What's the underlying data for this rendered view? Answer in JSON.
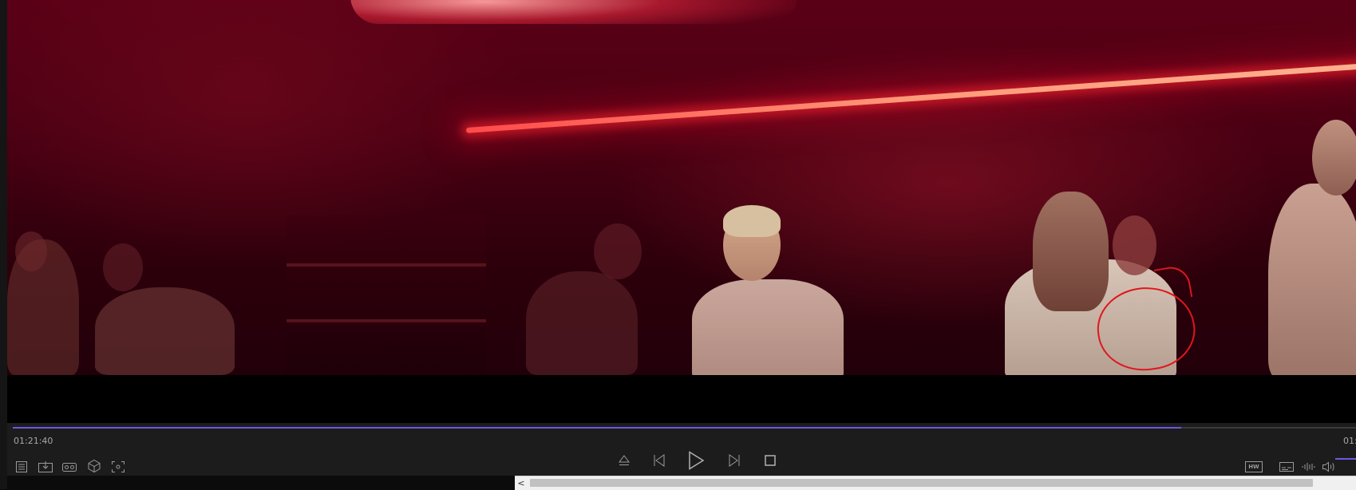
{
  "player": {
    "time_current": "01:21:40",
    "time_total": "01:",
    "progress": 0.87,
    "volume_level": 0.2,
    "accent_color": "#6e57e0",
    "controls_left": [
      {
        "icon": "playlist-icon"
      },
      {
        "icon": "download-icon"
      },
      {
        "icon": "vr-headset-icon"
      },
      {
        "icon": "3d-cube-icon"
      },
      {
        "icon": "screenshot-icon"
      }
    ],
    "controls_center": [
      {
        "icon": "eject-icon"
      },
      {
        "icon": "previous-track-icon"
      },
      {
        "icon": "play-icon"
      },
      {
        "icon": "next-track-icon"
      },
      {
        "icon": "stop-icon"
      }
    ],
    "controls_right": [
      {
        "icon": "hw-decoding-icon",
        "label": "HW"
      },
      {
        "icon": "subtitles-icon"
      },
      {
        "icon": "audio-track-icon"
      },
      {
        "icon": "volume-icon"
      }
    ]
  },
  "annotation": {
    "color": "#e0161e",
    "shape": "freehand circle"
  },
  "scrollbar": {
    "arrow": "<"
  }
}
